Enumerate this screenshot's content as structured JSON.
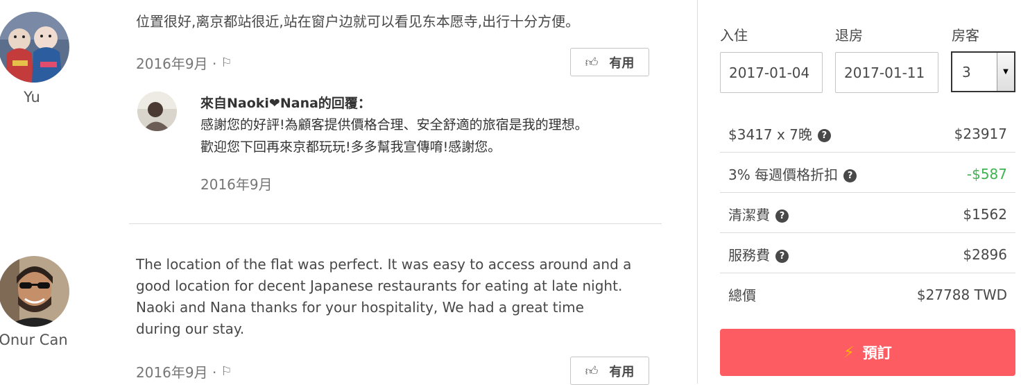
{
  "reviews": [
    {
      "reviewer": "Yu",
      "text": "位置很好,离京都站很近,站在窗户边就可以看见东本愿寺,出行十分方便。",
      "date": "2016年9月 ·",
      "helpful_label": "有用",
      "response": {
        "title": "來自Naoki❤Nana的回覆：",
        "lines": [
          "感謝您的好評!為顧客提供價格合理、安全舒適的旅宿是我的理想。",
          "歡迎您下回再來京都玩玩!多多幫我宣傳唷!感謝您。"
        ],
        "date": "2016年9月"
      }
    },
    {
      "reviewer": "Onur Can",
      "lines": [
        "The location of the flat was perfect. It was easy to access around and a",
        "good location for decent Japanese restaurants for eating at late night.",
        "Naoki and Nana thanks for your hospitality, We had a great time",
        "during our stay."
      ],
      "date": "2016年9月 ·",
      "helpful_label": "有用"
    }
  ],
  "booking": {
    "checkin_label": "入住",
    "checkout_label": "退房",
    "guests_label": "房客",
    "checkin_value": "2017-01-04",
    "checkout_value": "2017-01-11",
    "guests_value": "3",
    "price_rows": [
      {
        "label": "$3417 x 7晚",
        "value": "$23917",
        "info": true
      },
      {
        "label": "3% 每週價格折扣",
        "value": "-$587",
        "info": true
      },
      {
        "label": "清潔費",
        "value": "$1562",
        "info": true
      },
      {
        "label": "服務費",
        "value": "$2896",
        "info": true
      }
    ],
    "total_label": "總價",
    "total_value": "$27788 TWD",
    "book_label": "預訂"
  },
  "colors": {
    "discount": "#3fb34f",
    "book_button": "#fd5c63",
    "bolt": "#ffb400"
  }
}
